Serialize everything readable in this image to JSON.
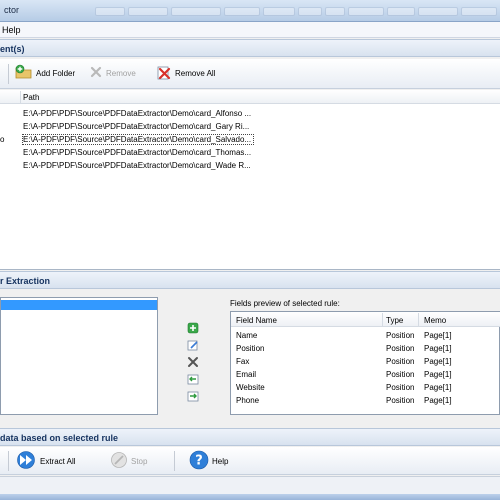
{
  "window": {
    "title": "ctor"
  },
  "menu": {
    "help": "Help"
  },
  "documents": {
    "header": "ent(s)",
    "toolbar": {
      "add_folder": "Add Folder",
      "remove": "Remove",
      "remove_all": "Remove All"
    },
    "column_path": "Path",
    "rows": [
      {
        "lead": "",
        "path": "E:\\A-PDF\\PDF\\Source\\PDFDataExtractor\\Demo\\card_Alfonso ..."
      },
      {
        "lead": "",
        "path": "E:\\A-PDF\\PDF\\Source\\PDFDataExtractor\\Demo\\card_Gary Ri..."
      },
      {
        "lead": "o",
        "path": "E:\\A-PDF\\PDF\\Source\\PDFDataExtractor\\Demo\\card_Salvado..."
      },
      {
        "lead": "",
        "path": "E:\\A-PDF\\PDF\\Source\\PDFDataExtractor\\Demo\\card_Thomas..."
      },
      {
        "lead": "",
        "path": "E:\\A-PDF\\PDF\\Source\\PDFDataExtractor\\Demo\\card_Wade R..."
      }
    ]
  },
  "rules": {
    "header": "r Extraction",
    "fields_label": "Fields preview of selected rule:",
    "columns": {
      "field_name": "Field Name",
      "type": "Type",
      "memo": "Memo"
    },
    "fields": [
      {
        "name": "Name",
        "type": "Position",
        "memo": "Page[1]"
      },
      {
        "name": "Position",
        "type": "Position",
        "memo": "Page[1]"
      },
      {
        "name": "Fax",
        "type": "Position",
        "memo": "Page[1]"
      },
      {
        "name": "Email",
        "type": "Position",
        "memo": "Page[1]"
      },
      {
        "name": "Website",
        "type": "Position",
        "memo": "Page[1]"
      },
      {
        "name": "Phone",
        "type": "Position",
        "memo": "Page[1]"
      }
    ]
  },
  "extract": {
    "header": "data based on selected rule",
    "toolbar": {
      "extract_all": "Extract All",
      "stop": "Stop",
      "help": "Help"
    }
  },
  "colors": {
    "selection": "#3399ff",
    "header_text": "#15325f",
    "disabled_text": "#a2a2a2"
  }
}
